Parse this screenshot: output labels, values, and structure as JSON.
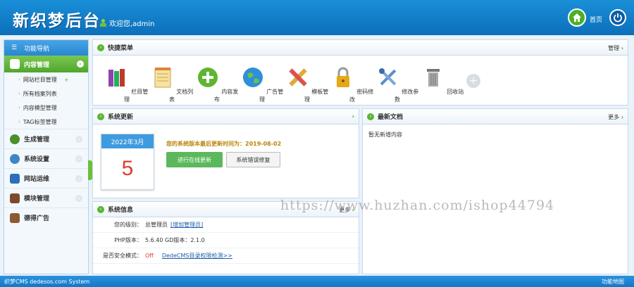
{
  "header": {
    "logo": "新织梦后台",
    "welcome": "欢迎您,admin",
    "home_label": "首页"
  },
  "sidebar": {
    "title": "功能导航",
    "active": "内容管理",
    "sub_items": [
      {
        "label": "网站栏目管理"
      },
      {
        "label": "所有档案列表"
      },
      {
        "label": "内容模型管理"
      },
      {
        "label": "TAG标签管理"
      }
    ],
    "items": [
      {
        "label": "生成管理",
        "icon": "tree-icon",
        "color": "#4a8f2a"
      },
      {
        "label": "系统设置",
        "icon": "gears-icon",
        "color": "#3f86c7"
      },
      {
        "label": "网站运维",
        "icon": "monitor-icon",
        "color": "#2c6fb8"
      },
      {
        "label": "模块管理",
        "icon": "book-icon",
        "color": "#7a4a2a"
      },
      {
        "label": "德得广告",
        "icon": "book-icon",
        "color": "#8a5a30"
      }
    ]
  },
  "quick_menu": {
    "title": "快捷菜单",
    "more": "管理",
    "items": [
      {
        "label": "栏目管理",
        "icon": "books-icon",
        "color": "#8e44ad"
      },
      {
        "label": "文档列表",
        "icon": "notepad-icon",
        "color": "#e0a93a"
      },
      {
        "label": "内容发布",
        "icon": "add-circle-icon",
        "color": "#5fb531"
      },
      {
        "label": "广告管理",
        "icon": "globe-icon",
        "color": "#2f8fd8"
      },
      {
        "label": "模板管理",
        "icon": "pencil-ruler-icon",
        "color": "#d9534f"
      },
      {
        "label": "密码修改",
        "icon": "lock-icon",
        "color": "#e6a817"
      },
      {
        "label": "修改参数",
        "icon": "tools-icon",
        "color": "#5b8fc9"
      },
      {
        "label": "回收站",
        "icon": "trash-icon",
        "color": "#888888"
      }
    ]
  },
  "system_update": {
    "title": "系统更新",
    "more": "›",
    "calendar_month": "2022年3月",
    "calendar_day": "5",
    "update_text": "您的系统版本最后更新时间为：2019-08-02",
    "online_update_button": "进行在线更新",
    "repair_button": "系统错误修复"
  },
  "latest_docs": {
    "title": "最新文档",
    "more": "更多",
    "empty_text": "暂无新增内容"
  },
  "system_info": {
    "title": "系统信息",
    "more": "更多",
    "rows": [
      {
        "label": "您的级别：",
        "value": "总管理员",
        "link": "[增加管理员]"
      },
      {
        "label": "PHP版本：",
        "value": "5.6.40   GD版本：2.1.0",
        "link": ""
      },
      {
        "label": "是否安全模式：",
        "value": "Off",
        "link": "DedeCMS目录权限检测>>"
      }
    ]
  },
  "footer": {
    "left": "织梦CMS  dedesos.com System",
    "right": "功能地图"
  },
  "watermark": "https://www.huzhan.com/ishop44794"
}
